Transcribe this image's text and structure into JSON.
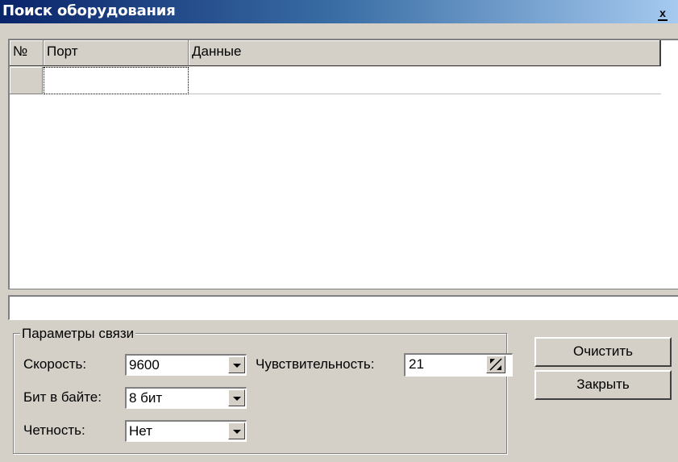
{
  "window": {
    "title": "Поиск оборудования",
    "close_label": "x"
  },
  "grid": {
    "columns": [
      "№",
      "Порт",
      "Данные"
    ],
    "rows": [
      {
        "num": "",
        "port": "",
        "data": ""
      }
    ]
  },
  "status": {
    "value": ""
  },
  "params": {
    "legend": "Параметры связи",
    "speed": {
      "label": "Скорость:",
      "value": "9600"
    },
    "bits": {
      "label": "Бит в байте:",
      "value": "8 бит"
    },
    "parity": {
      "label": "Четность:",
      "value": "Нет"
    },
    "sensitivity": {
      "label": "Чувствительность:",
      "value": "21"
    }
  },
  "buttons": {
    "clear": "Очистить",
    "close": "Закрыть"
  }
}
